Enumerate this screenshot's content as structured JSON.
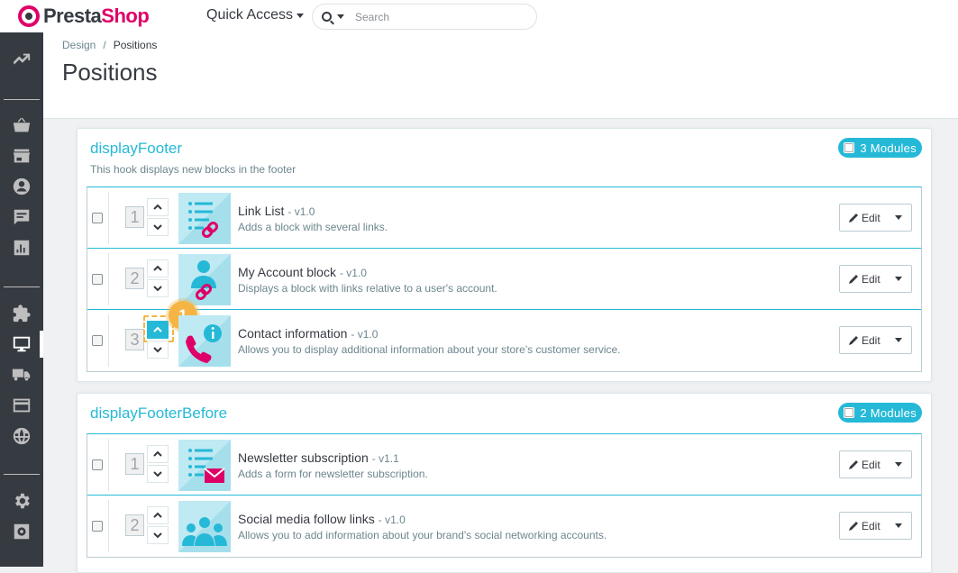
{
  "topbar": {
    "brand_prefix": "Presta",
    "brand_suffix": "Shop",
    "quick_access_label": "Quick Access",
    "search_placeholder": "Search"
  },
  "sidebar": {
    "items": [
      {
        "name": "dashboard-icon"
      },
      {
        "name": "orders-basket-icon"
      },
      {
        "name": "catalog-store-icon"
      },
      {
        "name": "customers-user-icon"
      },
      {
        "name": "customer-service-chat-icon"
      },
      {
        "name": "stats-bar-chart-icon"
      },
      {
        "name": "modules-puzzle-icon"
      },
      {
        "name": "design-monitor-icon",
        "active": true
      },
      {
        "name": "shipping-truck-icon"
      },
      {
        "name": "payment-card-icon"
      },
      {
        "name": "international-globe-icon"
      },
      {
        "name": "configure-gear-icon"
      },
      {
        "name": "advanced-parameters-gear-icon"
      }
    ]
  },
  "header": {
    "breadcrumb_parent": "Design",
    "breadcrumb_separator": "/",
    "breadcrumb_current": "Positions",
    "title": "Positions"
  },
  "hooks": [
    {
      "name": "displayFooter",
      "description": "This hook displays new blocks in the footer",
      "badge": "3 Modules",
      "modules": [
        {
          "position": "1",
          "name": "Link List",
          "version": "- v1.0",
          "description": "Adds a block with several links.",
          "image": "link-list-icon",
          "edit_label": "Edit"
        },
        {
          "position": "2",
          "name": "My Account block",
          "version": "- v1.0",
          "description": "Displays a block with links relative to a user's account.",
          "image": "account-link-icon",
          "edit_label": "Edit"
        },
        {
          "position": "3",
          "name": "Contact information",
          "version": "- v1.0",
          "description": "Allows you to display additional information about your store's customer service.",
          "image": "contact-phone-icon",
          "edit_label": "Edit"
        }
      ]
    },
    {
      "name": "displayFooterBefore",
      "description": "",
      "badge": "2 Modules",
      "modules": [
        {
          "position": "1",
          "name": "Newsletter subscription",
          "version": "- v1.1",
          "description": "Adds a form for newsletter subscription.",
          "image": "newsletter-mail-icon",
          "edit_label": "Edit"
        },
        {
          "position": "2",
          "name": "Social media follow links",
          "version": "- v1.0",
          "description": "Allows you to add information about your brand's social networking accounts.",
          "image": "social-people-icon",
          "edit_label": "Edit"
        }
      ]
    }
  ],
  "tutorial_step": "1",
  "colors": {
    "accent": "#25b9d7",
    "brand": "#df0067",
    "sidebar": "#363a41",
    "step_marker": "#f5b544"
  }
}
